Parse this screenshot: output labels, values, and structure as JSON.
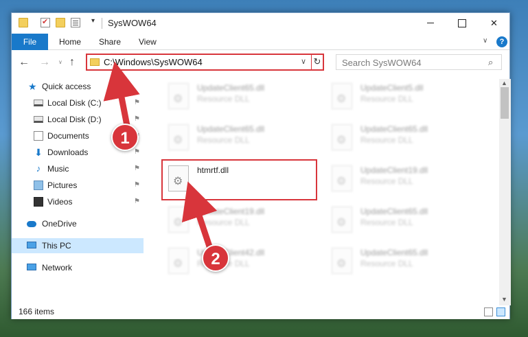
{
  "window": {
    "title": "SysWOW64",
    "qa_dropdown": "▾",
    "minimize": "",
    "maximize": "",
    "close": "✕"
  },
  "ribbon": {
    "file": "File",
    "tabs": [
      "Home",
      "Share",
      "View"
    ],
    "expand": "∨",
    "help": "?"
  },
  "nav": {
    "back": "←",
    "forward": "→",
    "recent": "∨",
    "up": "↑",
    "address": "C:\\Windows\\SysWOW64",
    "address_chevron": "∨",
    "refresh": "↻",
    "search_placeholder": "Search SysWOW64",
    "search_icon": "⌕"
  },
  "sidebar": {
    "items": [
      {
        "label": "Quick access",
        "icon": "star-icon",
        "glyph": "★",
        "pinned": false
      },
      {
        "label": "Local Disk (C:)",
        "icon": "disk-icon",
        "pinned": true
      },
      {
        "label": "Local Disk (D:)",
        "icon": "disk-icon",
        "pinned": true
      },
      {
        "label": "Documents",
        "icon": "documents-icon",
        "pinned": true
      },
      {
        "label": "Downloads",
        "icon": "download-icon",
        "glyph": "⬇",
        "pinned": true
      },
      {
        "label": "Music",
        "icon": "music-icon",
        "glyph": "♪",
        "pinned": true
      },
      {
        "label": "Pictures",
        "icon": "pictures-icon",
        "pinned": true
      },
      {
        "label": "Videos",
        "icon": "videos-icon",
        "pinned": true
      },
      {
        "label": "OneDrive",
        "icon": "cloud-icon",
        "pinned": false
      },
      {
        "label": "This PC",
        "icon": "computer-icon",
        "pinned": false,
        "selected": true
      },
      {
        "label": "Network",
        "icon": "network-icon",
        "pinned": false
      }
    ],
    "pin_glyph": "📌"
  },
  "files": [
    {
      "name": "UpdateClient65.dll",
      "type": "Resource DLL",
      "blurred": true
    },
    {
      "name": "UpdateClient5.dll",
      "type": "Resource DLL",
      "blurred": true
    },
    {
      "name": "UpdateClient65.dll",
      "type": "Resource DLL",
      "blurred": true
    },
    {
      "name": "UpdateClient65.dll",
      "type": "Resource DLL",
      "blurred": true
    },
    {
      "name": "htmrtf.dll",
      "type": "",
      "blurred": false,
      "highlighted": true
    },
    {
      "name": "UpdateClient19.dll",
      "type": "Resource DLL",
      "blurred": true
    },
    {
      "name": "UpdateClient19.dll",
      "type": "Resource DLL",
      "blurred": true
    },
    {
      "name": "UpdateClient65.dll",
      "type": "Resource DLL",
      "blurred": true
    },
    {
      "name": "UpdateClient42.dll",
      "type": "Resource DLL",
      "blurred": true
    },
    {
      "name": "UpdateClient65.dll",
      "type": "Resource DLL",
      "blurred": true
    }
  ],
  "status": {
    "item_count": "166 items"
  },
  "annotations": {
    "badge1": "1",
    "badge2": "2",
    "color": "#d8353b"
  },
  "colors": {
    "accent": "#1979ca",
    "selection": "#cce8ff",
    "highlight": "#d8353b"
  }
}
